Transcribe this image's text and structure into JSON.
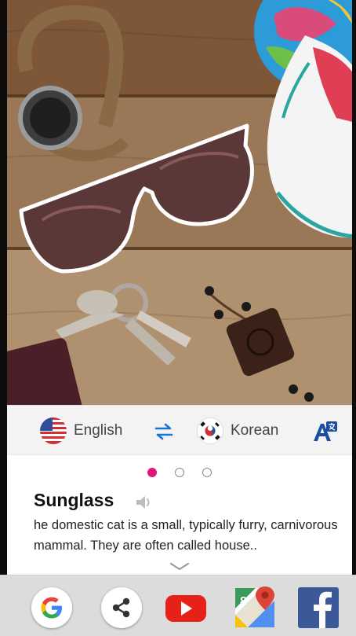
{
  "photo": {
    "subject": "sunglasses highlighted with white outline on wooden table with watch, keys, sneaker, globe"
  },
  "language_bar": {
    "source_language": "English",
    "target_language": "Korean",
    "source_flag": "us-flag-icon",
    "target_flag": "korea-flag-icon",
    "swap_icon": "swap-arrows-icon",
    "translate_icon": "translate-icon"
  },
  "pager": {
    "count": 3,
    "active_index": 0,
    "active_color": "#e0157a"
  },
  "result": {
    "word": "Sunglass",
    "definition": "he domestic cat is a small, typically furry, carnivorous mammal. They are often called house.."
  },
  "dock": {
    "apps": [
      "google-icon",
      "share-icon",
      "youtube-icon",
      "google-maps-icon",
      "facebook-icon"
    ]
  },
  "colors": {
    "accent": "#e0157a",
    "swap_blue": "#1976d2",
    "translate_blue": "#1a4ea2"
  }
}
